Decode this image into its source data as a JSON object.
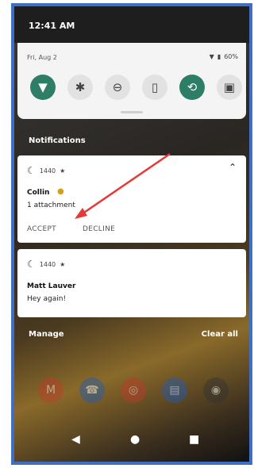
{
  "status_bar": {
    "time": "12:41 AM"
  },
  "quick_settings": {
    "date": "Fri, Aug 2",
    "battery": "60%",
    "tiles": [
      {
        "icon": "wifi-icon",
        "glyph": "▼",
        "active": true
      },
      {
        "icon": "bluetooth-icon",
        "glyph": "✱",
        "active": false
      },
      {
        "icon": "do-not-disturb-icon",
        "glyph": "⊖",
        "active": false
      },
      {
        "icon": "flashlight-icon",
        "glyph": "▯",
        "active": false
      },
      {
        "icon": "auto-rotate-icon",
        "glyph": "⟲",
        "active": true
      },
      {
        "icon": "battery-saver-icon",
        "glyph": "▣",
        "active": false
      }
    ]
  },
  "notifications": {
    "header": "Notifications",
    "items": [
      {
        "app": "1440",
        "sender": "Collin",
        "body": "1 attachment",
        "actions": [
          "ACCEPT",
          "DECLINE"
        ]
      },
      {
        "app": "1440",
        "sender": "Matt Lauver",
        "body": "Hey again!"
      }
    ]
  },
  "footer": {
    "manage": "Manage",
    "clear_all": "Clear all"
  },
  "colors": {
    "accent": "#2e7d67",
    "annotation_arrow": "#e53935",
    "frame_border": "#3f6fc4"
  }
}
